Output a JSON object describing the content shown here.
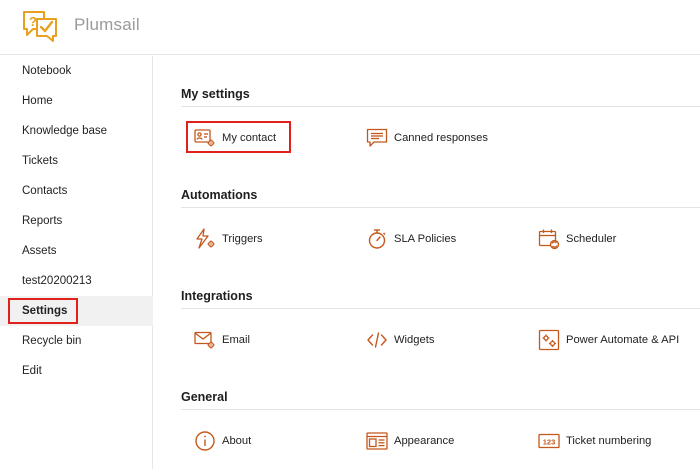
{
  "app": {
    "brand": "Plumsail"
  },
  "colors": {
    "accent": "#c4581b",
    "logo": "#e9a01f",
    "highlight": "#e0201b",
    "active_bg": "#f1f1f1"
  },
  "sidebar": {
    "items": [
      {
        "label": "Notebook"
      },
      {
        "label": "Home"
      },
      {
        "label": "Knowledge base"
      },
      {
        "label": "Tickets"
      },
      {
        "label": "Contacts"
      },
      {
        "label": "Reports"
      },
      {
        "label": "Assets"
      },
      {
        "label": "test20200213"
      },
      {
        "label": "Settings",
        "active": true
      },
      {
        "label": "Recycle bin"
      },
      {
        "label": "Edit"
      }
    ]
  },
  "sections": [
    {
      "title": "My settings",
      "items": [
        {
          "label": "My contact",
          "icon": "contact-card-gear-icon",
          "highlighted": true
        },
        {
          "label": "Canned responses",
          "icon": "speech-bubble-lines-icon"
        }
      ]
    },
    {
      "title": "Automations",
      "items": [
        {
          "label": "Triggers",
          "icon": "lightning-gear-icon"
        },
        {
          "label": "SLA Policies",
          "icon": "stopwatch-icon"
        },
        {
          "label": "Scheduler",
          "icon": "calendar-refresh-icon"
        }
      ]
    },
    {
      "title": "Integrations",
      "items": [
        {
          "label": "Email",
          "icon": "envelope-gear-icon"
        },
        {
          "label": "Widgets",
          "icon": "code-brackets-icon"
        },
        {
          "label": "Power Automate & API",
          "icon": "window-gears-icon"
        }
      ]
    },
    {
      "title": "General",
      "items": [
        {
          "label": "About",
          "icon": "info-circle-icon"
        },
        {
          "label": "Appearance",
          "icon": "layout-window-icon"
        },
        {
          "label": "Ticket numbering",
          "icon": "number-box-icon"
        }
      ]
    }
  ]
}
